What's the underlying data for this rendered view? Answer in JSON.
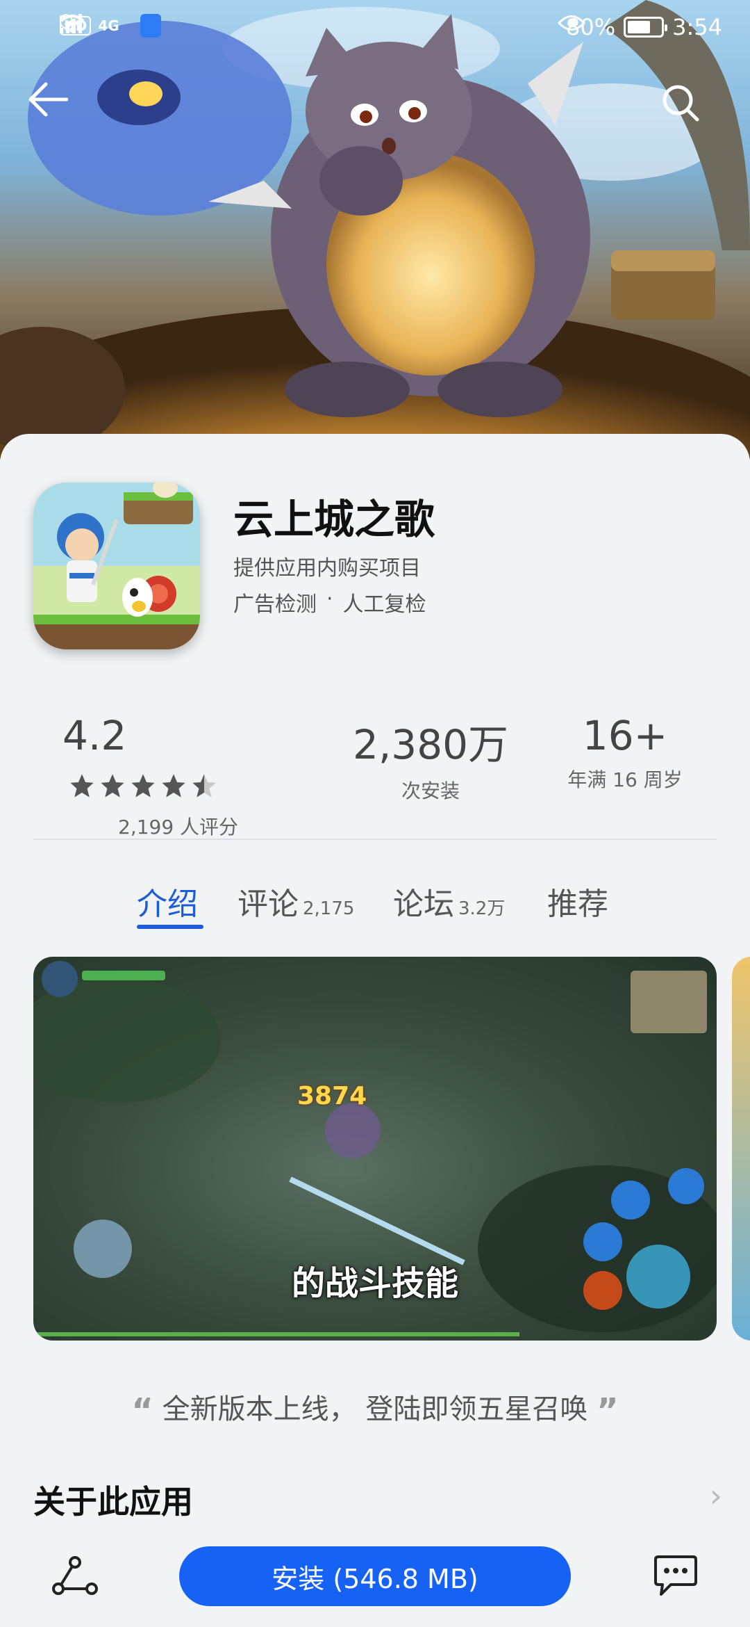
{
  "status_bar": {
    "hd": "HD",
    "network": "4G",
    "battery_percent": "80%",
    "time": "3:54"
  },
  "app": {
    "name": "云上城之歌",
    "in_app_purchase": "提供应用内购买项目",
    "check_1": "广告检测",
    "separator": "·",
    "check_2": "人工复检"
  },
  "stats": {
    "rating": "4.2",
    "rating_count": "2,199 人评分",
    "installs": "2,380万",
    "installs_label": "次安装",
    "age": "16+",
    "age_label": "年满 16 周岁"
  },
  "tabs": [
    {
      "label": "介绍",
      "count": ""
    },
    {
      "label": "评论",
      "count": "2,175"
    },
    {
      "label": "论坛",
      "count": "3.2万"
    },
    {
      "label": "推荐",
      "count": ""
    }
  ],
  "screenshot": {
    "caption": "的战斗技能",
    "damage": "3874"
  },
  "tagline": "全新版本上线， 登陆即领五星召唤",
  "about_label": "关于此应用",
  "install_label": "安装 (546.8 MB)",
  "colors": {
    "accent": "#1e5bd8",
    "install_button": "#1662f5",
    "background": "#f1f3f5"
  }
}
